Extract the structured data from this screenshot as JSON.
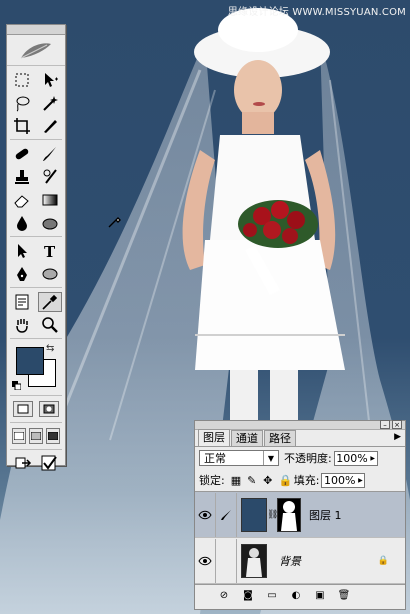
{
  "watermark": "思缘设计论坛 WWW.MISSYUAN.COM",
  "toolbox": {
    "icons": [
      "feather-icon",
      "marquee-icon",
      "move-icon",
      "lasso-icon",
      "magic-wand-icon",
      "crop-icon",
      "slice-icon",
      "healing-brush-icon",
      "brush-icon",
      "clone-stamp-icon",
      "history-brush-icon",
      "eraser-icon",
      "gradient-icon",
      "blur-icon",
      "dodge-icon",
      "path-select-icon",
      "type-icon",
      "pen-icon",
      "ellipse-icon",
      "notes-icon",
      "eyedropper-icon",
      "hand-icon",
      "zoom-icon"
    ],
    "foreground_color": "#2b4a6a",
    "background_color": "#ffffff"
  },
  "layers_panel": {
    "tabs": [
      "图层",
      "通道",
      "路径"
    ],
    "blend_mode": "正常",
    "opacity_label": "不透明度:",
    "opacity_value": "100%",
    "lock_label": "锁定:",
    "fill_label": "填充:",
    "fill_value": "100%",
    "layers": [
      {
        "name": "图层 1",
        "selected": true
      },
      {
        "name": "背景",
        "selected": false
      }
    ]
  },
  "colors": {
    "canvas_bg": "#2d4b6c",
    "selected_layer": "#b6bfcc"
  }
}
